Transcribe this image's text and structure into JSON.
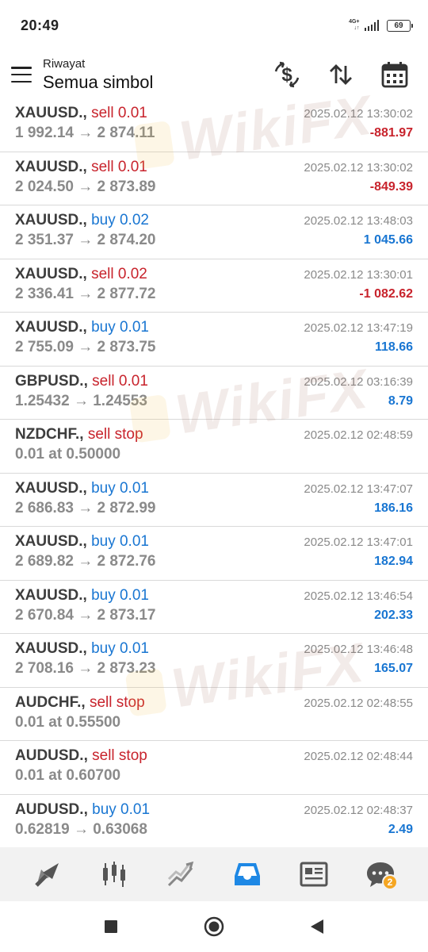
{
  "status": {
    "time": "20:49",
    "network": "4G+",
    "battery": "69"
  },
  "toolbar": {
    "subtitle": "Riwayat",
    "title": "Semua simbol"
  },
  "rows": [
    {
      "symbol": "XAUUSD.",
      "action": "sell 0.01",
      "side": "sell",
      "prices": "1 992.14 → 2 874.11",
      "date": "2025.02.12 13:30:02",
      "profit": "-881.97"
    },
    {
      "symbol": "XAUUSD.",
      "action": "sell 0.01",
      "side": "sell",
      "prices": "2 024.50 → 2 873.89",
      "date": "2025.02.12 13:30:02",
      "profit": "-849.39"
    },
    {
      "symbol": "XAUUSD.",
      "action": "buy 0.02",
      "side": "buy",
      "prices": "2 351.37 → 2 874.20",
      "date": "2025.02.12 13:48:03",
      "profit": "1 045.66"
    },
    {
      "symbol": "XAUUSD.",
      "action": "sell 0.02",
      "side": "sell",
      "prices": "2 336.41 → 2 877.72",
      "date": "2025.02.12 13:30:01",
      "profit": "-1 082.62"
    },
    {
      "symbol": "XAUUSD.",
      "action": "buy 0.01",
      "side": "buy",
      "prices": "2 755.09 → 2 873.75",
      "date": "2025.02.12 13:47:19",
      "profit": "118.66"
    },
    {
      "symbol": "GBPUSD.",
      "action": "sell 0.01",
      "side": "sell",
      "prices": "1.25432 → 1.24553",
      "date": "2025.02.12 03:16:39",
      "profit": "8.79"
    },
    {
      "symbol": "NZDCHF.",
      "action": "sell stop",
      "side": "sell",
      "prices": "0.01 at 0.50000",
      "date": "2025.02.12 02:48:59",
      "profit": ""
    },
    {
      "symbol": "XAUUSD.",
      "action": "buy 0.01",
      "side": "buy",
      "prices": "2 686.83 → 2 872.99",
      "date": "2025.02.12 13:47:07",
      "profit": "186.16"
    },
    {
      "symbol": "XAUUSD.",
      "action": "buy 0.01",
      "side": "buy",
      "prices": "2 689.82 → 2 872.76",
      "date": "2025.02.12 13:47:01",
      "profit": "182.94"
    },
    {
      "symbol": "XAUUSD.",
      "action": "buy 0.01",
      "side": "buy",
      "prices": "2 670.84 → 2 873.17",
      "date": "2025.02.12 13:46:54",
      "profit": "202.33"
    },
    {
      "symbol": "XAUUSD.",
      "action": "buy 0.01",
      "side": "buy",
      "prices": "2 708.16 → 2 873.23",
      "date": "2025.02.12 13:46:48",
      "profit": "165.07"
    },
    {
      "symbol": "AUDCHF.",
      "action": "sell stop",
      "side": "sell",
      "prices": "0.01 at 0.55500",
      "date": "2025.02.12 02:48:55",
      "profit": ""
    },
    {
      "symbol": "AUDUSD.",
      "action": "sell stop",
      "side": "sell",
      "prices": "0.01 at 0.60700",
      "date": "2025.02.12 02:48:44",
      "profit": ""
    },
    {
      "symbol": "AUDUSD.",
      "action": "buy 0.01",
      "side": "buy",
      "prices": "0.62819 → 0.63068",
      "date": "2025.02.12 02:48:37",
      "profit": "2.49"
    }
  ],
  "watermark": "WikiFX",
  "bottom_nav": {
    "items": [
      "quotes-icon",
      "chart-icon",
      "trade-icon",
      "history-icon",
      "news-icon",
      "chat-icon"
    ],
    "active": "history-icon",
    "chat_badge": "2"
  },
  "colors": {
    "sell": "#c8232c",
    "buy": "#1976d2",
    "active_nav": "#1e88e5",
    "badge": "#f5a623"
  }
}
